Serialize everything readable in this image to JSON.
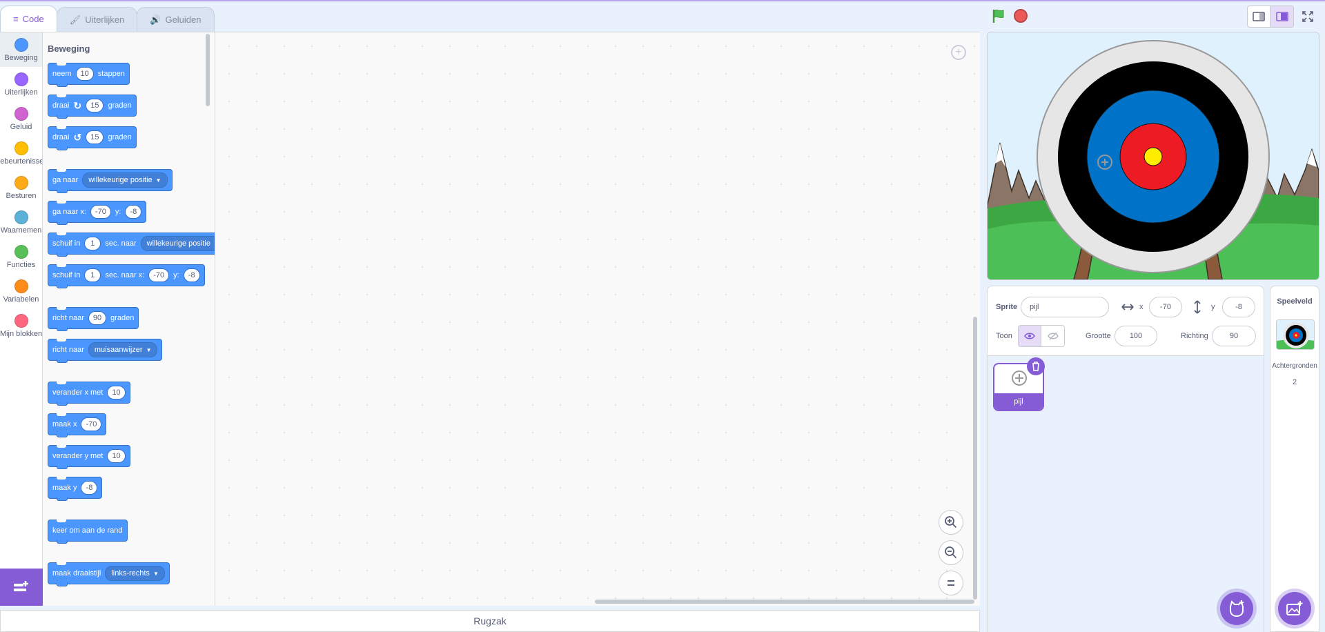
{
  "tabs": [
    {
      "label": "Code",
      "icon": "code-icon"
    },
    {
      "label": "Uiterlijken",
      "icon": "brush-icon"
    },
    {
      "label": "Geluiden",
      "icon": "speaker-icon"
    }
  ],
  "categories": [
    {
      "label": "Beweging",
      "color": "#4c97ff"
    },
    {
      "label": "Uiterlijken",
      "color": "#9966ff"
    },
    {
      "label": "Geluid",
      "color": "#cf63cf"
    },
    {
      "label": "Gebeurtenissen",
      "color": "#ffbf00"
    },
    {
      "label": "Besturen",
      "color": "#ffab19"
    },
    {
      "label": "Waarnemen",
      "color": "#5cb1d6"
    },
    {
      "label": "Functies",
      "color": "#59c059"
    },
    {
      "label": "Variabelen",
      "color": "#ff8c1a"
    },
    {
      "label": "Mijn blokken",
      "color": "#ff6680"
    }
  ],
  "palette": {
    "title": "Beweging",
    "blocks": {
      "move": {
        "a": "neem",
        "v": "10",
        "b": "stappen"
      },
      "turn_right": {
        "a": "draai",
        "v": "15",
        "b": "graden"
      },
      "turn_left": {
        "a": "draai",
        "v": "15",
        "b": "graden"
      },
      "goto": {
        "a": "ga naar",
        "d": "willekeurige positie"
      },
      "goto_xy": {
        "a": "ga naar x:",
        "x": "-70",
        "b": "y:",
        "y": "-8"
      },
      "glide_to": {
        "a": "schuif in",
        "v": "1",
        "b": "sec. naar",
        "d": "willekeurige positie"
      },
      "glide_xy": {
        "a": "schuif in",
        "v": "1",
        "b": "sec. naar x:",
        "x": "-70",
        "c": "y:",
        "y": "-8"
      },
      "point_dir": {
        "a": "richt naar",
        "v": "90",
        "b": "graden"
      },
      "point_towards": {
        "a": "richt naar",
        "d": "muisaanwijzer"
      },
      "change_x": {
        "a": "verander x met",
        "v": "10"
      },
      "set_x": {
        "a": "maak x",
        "v": "-70"
      },
      "change_y": {
        "a": "verander y met",
        "v": "10"
      },
      "set_y": {
        "a": "maak y",
        "v": "-8"
      },
      "bounce": {
        "a": "keer om aan de rand"
      },
      "rotation_style": {
        "a": "maak draaistijl",
        "d": "links-rechts"
      }
    }
  },
  "backpack": {
    "label": "Rugzak"
  },
  "sprite_info": {
    "sprite_label": "Sprite",
    "sprite_name": "pijl",
    "x_label": "x",
    "x_value": "-70",
    "y_label": "y",
    "y_value": "-8",
    "show_label": "Toon",
    "size_label": "Grootte",
    "size_value": "100",
    "direction_label": "Richting",
    "direction_value": "90"
  },
  "sprites": [
    {
      "name": "pijl"
    }
  ],
  "stage_pane": {
    "title": "Speelveld",
    "backdrops_label": "Achtergronden",
    "backdrops_count": "2"
  },
  "colors": {
    "motion": "#4c97ff",
    "accent": "#855cd6",
    "stop": "#ec5959",
    "flag": "#4cbf56"
  }
}
